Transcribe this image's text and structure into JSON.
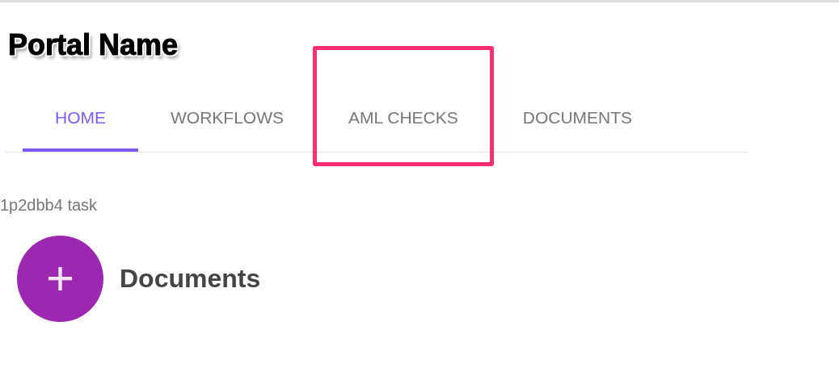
{
  "portal": {
    "title": "Portal Name"
  },
  "tabs": [
    {
      "label": "HOME",
      "selected": true,
      "highlighted": false
    },
    {
      "label": "WORKFLOWS",
      "selected": false,
      "highlighted": false
    },
    {
      "label": "AML CHECKS",
      "selected": false,
      "highlighted": true
    },
    {
      "label": "DOCUMENTS",
      "selected": false,
      "highlighted": false
    }
  ],
  "task_label": "1p2dbb4 task",
  "action": {
    "icon": "+",
    "label": "Documents"
  }
}
